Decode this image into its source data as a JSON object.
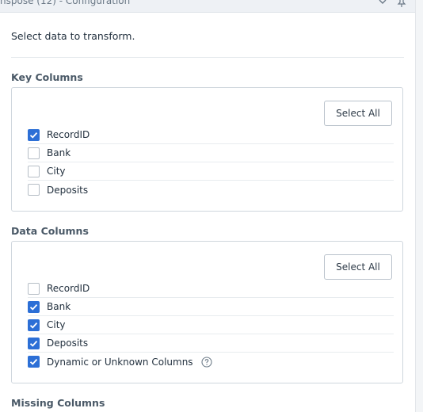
{
  "window": {
    "title": "nspose (12) - Configuration"
  },
  "intro_text": "Select data to transform.",
  "key_columns": {
    "title": "Key Columns",
    "select_all_label": "Select All",
    "items": [
      {
        "label": "RecordID",
        "checked": true
      },
      {
        "label": "Bank",
        "checked": false
      },
      {
        "label": "City",
        "checked": false
      },
      {
        "label": "Deposits",
        "checked": false
      }
    ]
  },
  "data_columns": {
    "title": "Data Columns",
    "select_all_label": "Select All",
    "items": [
      {
        "label": "RecordID",
        "checked": false
      },
      {
        "label": "Bank",
        "checked": true
      },
      {
        "label": "City",
        "checked": true
      },
      {
        "label": "Deposits",
        "checked": true
      },
      {
        "label": "Dynamic or Unknown Columns",
        "checked": true,
        "help_icon": "help-circle-icon"
      }
    ]
  },
  "missing_columns": {
    "title": "Missing Columns"
  },
  "colors": {
    "accent": "#2c6fd6",
    "border": "#cfd6dd",
    "heading": "#4a5967"
  }
}
